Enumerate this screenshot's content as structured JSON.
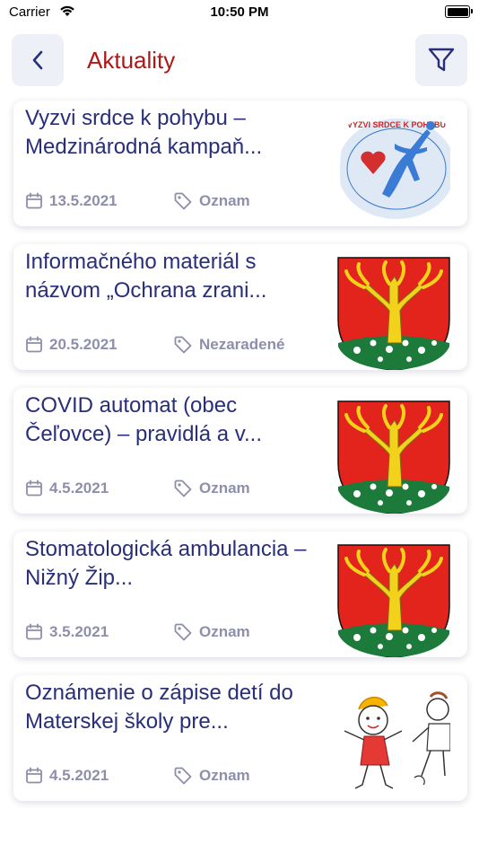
{
  "status_bar": {
    "carrier": "Carrier",
    "time": "10:50 PM"
  },
  "header": {
    "title": "Aktuality",
    "back_icon": "chevron-left-icon",
    "filter_icon": "filter-icon"
  },
  "colors": {
    "title_red": "#b01616",
    "card_title_blue": "#282e79",
    "meta_gray": "#8d8fab",
    "button_bg": "#eef0f7"
  },
  "articles": [
    {
      "title": "Vyzvi srdce k pohybu – Medzinárodná kampaň...",
      "date": "13.5.2021",
      "category": "Oznam",
      "image": "campaign-logo",
      "logo_text": "VYZVI SRDCE K POHYBU"
    },
    {
      "title": "Informačného materiál  s názvom „Ochrana zrani...",
      "date": "20.5.2021",
      "category": "Nezaradené",
      "image": "coat-of-arms"
    },
    {
      "title": "COVID automat (obec Čeľovce)  – pravidlá a v...",
      "date": "4.5.2021",
      "category": "Oznam",
      "image": "coat-of-arms"
    },
    {
      "title": "Stomatologická ambulancia – Nižný Žip...",
      "date": "3.5.2021",
      "category": "Oznam",
      "image": "coat-of-arms"
    },
    {
      "title": "Oznámenie o zápise detí do Materskej školy pre...",
      "date": "4.5.2021",
      "category": "Oznam",
      "image": "children-drawing"
    }
  ]
}
